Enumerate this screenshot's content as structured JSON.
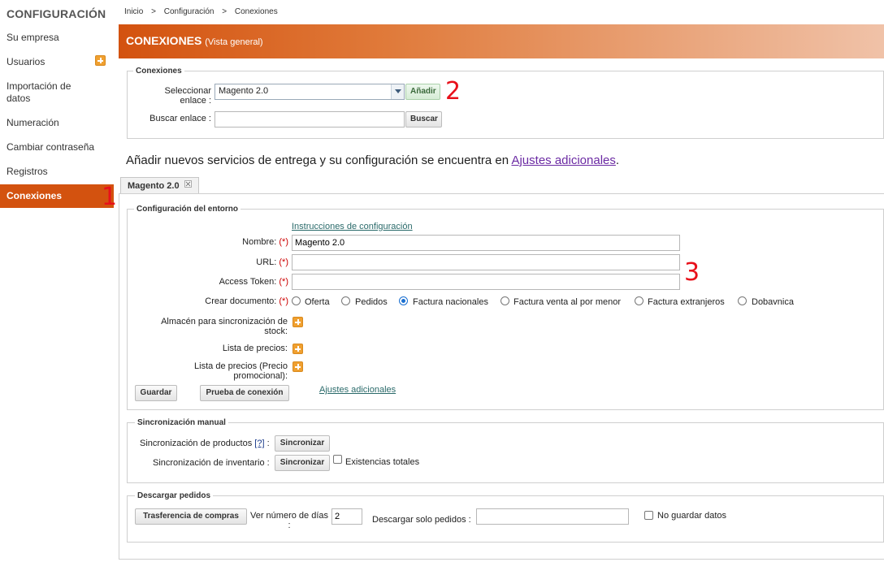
{
  "sidebar": {
    "title": "CONFIGURACIÓN",
    "items": [
      {
        "label": "Su empresa"
      },
      {
        "label": "Usuarios"
      },
      {
        "label": "Importación de datos"
      },
      {
        "label": "Numeración"
      },
      {
        "label": "Cambiar contraseña"
      },
      {
        "label": "Registros"
      },
      {
        "label": "Conexiones",
        "active": true
      }
    ]
  },
  "annotations": [
    "1",
    "2",
    "3"
  ],
  "breadcrumb": [
    "Inicio",
    ">",
    "Configuración",
    ">",
    "Conexiones"
  ],
  "banner": {
    "title": "CONEXIONES",
    "subtitle": "(Vista general)"
  },
  "connections": {
    "legend": "Conexiones",
    "select_label": "Seleccionar enlace :",
    "select_value": "Magento 2.0",
    "add_button": "Añadir",
    "search_label": "Buscar enlace :",
    "search_value": "",
    "search_button": "Buscar"
  },
  "info": {
    "text": "Añadir nuevos servicios de entrega y su configuración se encuentra en ",
    "link": "Ajustes adicionales",
    "end": "."
  },
  "tab": {
    "label": "Magento 2.0"
  },
  "environment": {
    "legend": "Configuración del entorno",
    "instructions_link": "Instrucciones de configuración",
    "required_mark": "(*)",
    "name_label": "Nombre:",
    "name_value": "Magento 2.0",
    "url_label": "URL:",
    "url_value": "",
    "token_label": "Access Token:",
    "token_value": "",
    "create_doc_label": "Crear documento:",
    "doc_options": [
      {
        "label": "Oferta",
        "selected": false
      },
      {
        "label": "Pedidos",
        "selected": false
      },
      {
        "label": "Factura nacionales",
        "selected": true
      },
      {
        "label": "Factura venta al por menor",
        "selected": false
      },
      {
        "label": "Factura extranjeros",
        "selected": false
      },
      {
        "label": "Dobavnica",
        "selected": false
      }
    ],
    "warehouse_label": "Almacén para sincronización de stock:",
    "pricelist_label": "Lista de precios:",
    "promo_pricelist_label": "Lista de precios (Precio promocional):",
    "save_button": "Guardar",
    "test_button": "Prueba de conexión",
    "additional_link": "Ajustes adicionales"
  },
  "manual_sync": {
    "legend": "Sincronización manual",
    "products_label": "Sincronización de productos",
    "help_link": "[?]",
    "colon": ":",
    "sync_button": "Sincronizar",
    "inventory_label": "Sincronización de inventario :",
    "total_stock_label": "Existencias totales",
    "total_stock_checked": false
  },
  "download_orders": {
    "legend": "Descargar pedidos",
    "transfer_button": "Trasferencia de compras",
    "days_label": "Ver número de días :",
    "days_value": "2",
    "only_orders_label": "Descargar solo pedidos :",
    "only_orders_value": "",
    "no_save_label": "No guardar datos",
    "no_save_checked": false
  },
  "colors": {
    "accent": "#d3520f",
    "annotation": "#e8101a",
    "link": "#2a6a6a"
  }
}
